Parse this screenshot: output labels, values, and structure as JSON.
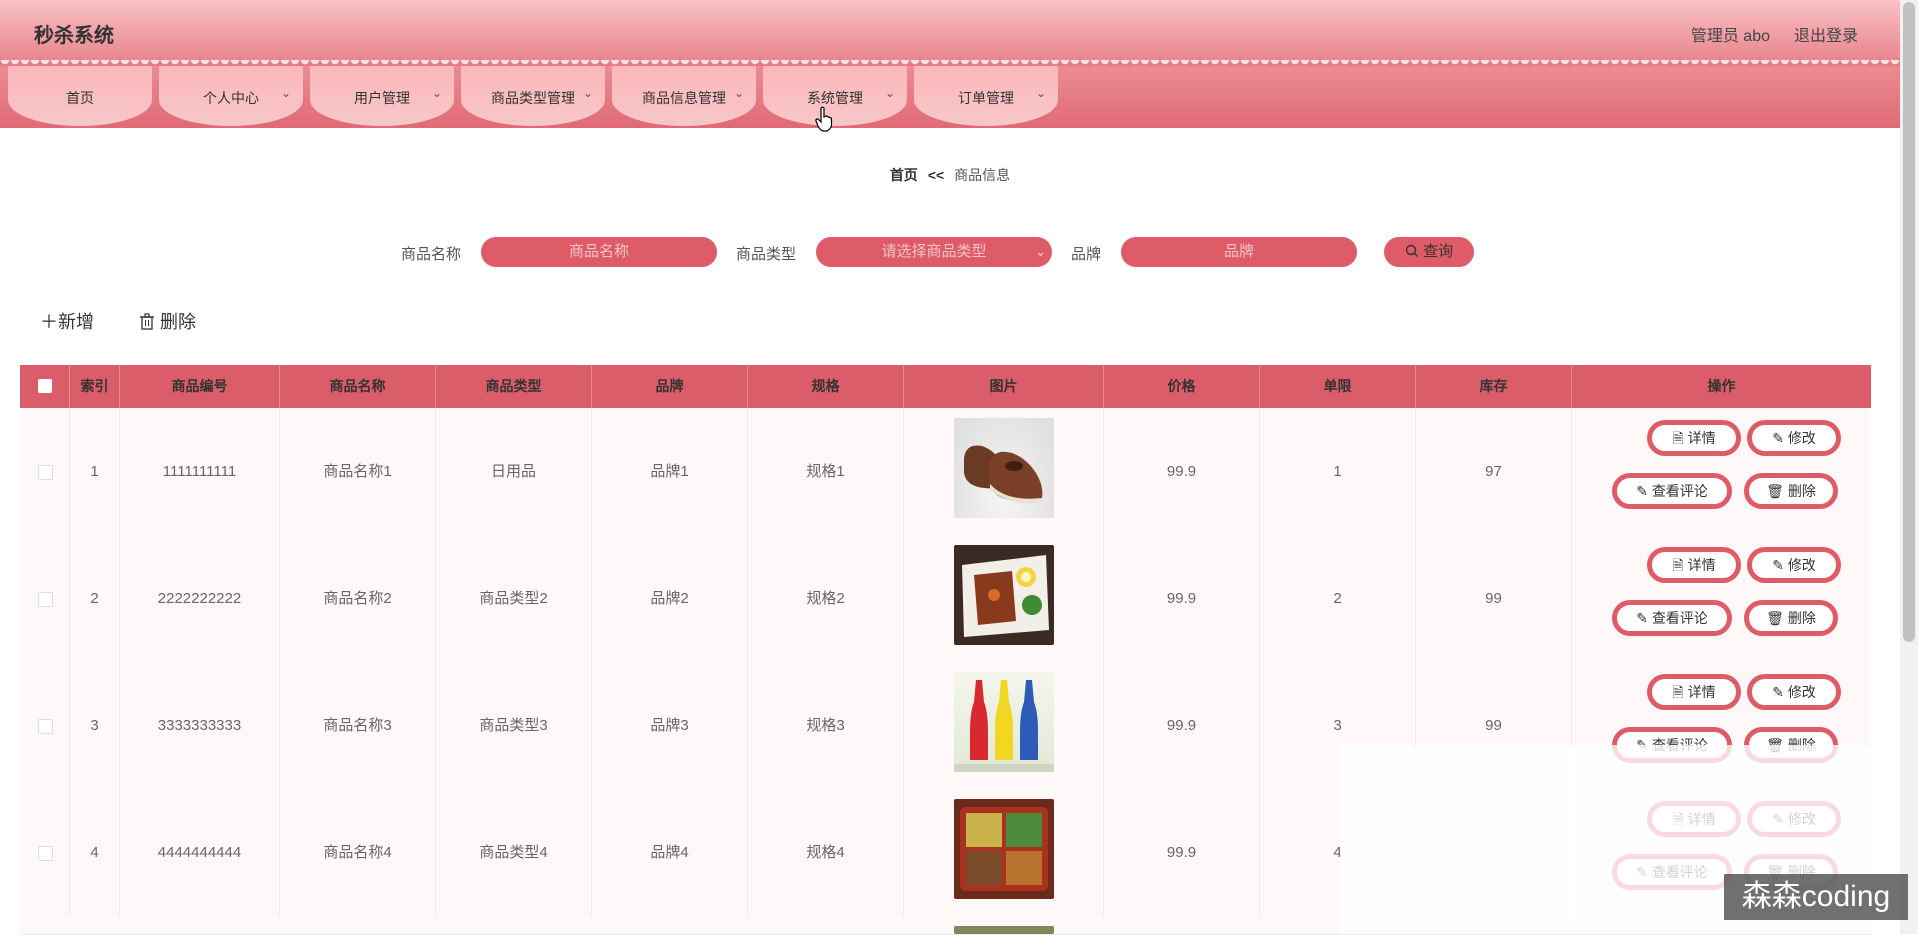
{
  "header": {
    "title": "秒杀系统",
    "user": "管理员 abo",
    "logout": "退出登录"
  },
  "nav": [
    {
      "label": "首页",
      "has_dropdown": false
    },
    {
      "label": "个人中心",
      "has_dropdown": true
    },
    {
      "label": "用户管理",
      "has_dropdown": true
    },
    {
      "label": "商品类型管理",
      "has_dropdown": true
    },
    {
      "label": "商品信息管理",
      "has_dropdown": true
    },
    {
      "label": "系统管理",
      "has_dropdown": true
    },
    {
      "label": "订单管理",
      "has_dropdown": true
    }
  ],
  "breadcrumb": {
    "home": "首页",
    "sep": "<<",
    "current": "商品信息"
  },
  "search": {
    "name_label": "商品名称",
    "name_placeholder": "商品名称",
    "type_label": "商品类型",
    "type_placeholder": "请选择商品类型",
    "brand_label": "品牌",
    "brand_placeholder": "品牌",
    "query": "查询"
  },
  "actions": {
    "add": "新增",
    "delete": "删除"
  },
  "table": {
    "headers": [
      "索引",
      "商品编号",
      "商品名称",
      "商品类型",
      "品牌",
      "规格",
      "图片",
      "价格",
      "单限",
      "库存",
      "操作"
    ],
    "rows": [
      {
        "index": "1",
        "code": "1111111111",
        "name": "商品名称1",
        "type": "日用品",
        "brand": "品牌1",
        "spec": "规格1",
        "image": "leather-shoes",
        "price": "99.9",
        "limit": "1",
        "stock": "97"
      },
      {
        "index": "2",
        "code": "2222222222",
        "name": "商品名称2",
        "type": "商品类型2",
        "brand": "品牌2",
        "spec": "规格2",
        "image": "bento-meal",
        "price": "99.9",
        "limit": "2",
        "stock": "99"
      },
      {
        "index": "3",
        "code": "3333333333",
        "name": "商品名称3",
        "type": "商品类型3",
        "brand": "品牌3",
        "spec": "规格3",
        "image": "colored-bottles",
        "price": "99.9",
        "limit": "3",
        "stock": "99"
      },
      {
        "index": "4",
        "code": "4444444444",
        "name": "商品名称4",
        "type": "商品类型4",
        "brand": "品牌4",
        "spec": "规格4",
        "image": "lunch-box",
        "price": "99.9",
        "limit": "4",
        "stock": ""
      }
    ],
    "ops": {
      "detail": "详情",
      "edit": "修改",
      "comments": "查看评论",
      "delete": "删除"
    }
  },
  "watermark": "森森coding",
  "colors": {
    "accent": "#de5b68",
    "header_top": "#f9c2c5",
    "nav_tab": "#fbb7ba"
  }
}
